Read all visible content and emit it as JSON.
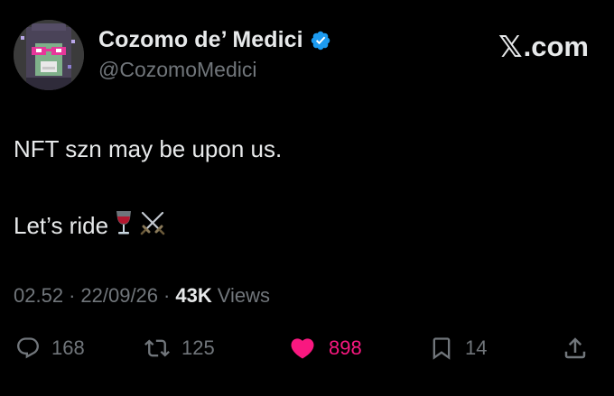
{
  "author": {
    "display_name": "Cozomo de’ Medici",
    "handle": "@CozomoMedici",
    "verified": true,
    "verified_color": "#1d9bf0"
  },
  "brand": {
    "x_glyph": "𝕏",
    "suffix": ".com"
  },
  "tweet": {
    "line1": "NFT szn may be upon us.",
    "line2_text": "Let’s ride",
    "line2_emoji": [
      "wine-glass-icon",
      "crossed-swords-icon"
    ]
  },
  "meta": {
    "time": "02.52",
    "separator": "·",
    "date": "22/09/26",
    "views_count": "43K",
    "views_label": "Views"
  },
  "actions": {
    "replies": "168",
    "reposts": "125",
    "likes": "898",
    "bookmarks": "14"
  },
  "colors": {
    "background": "#000000",
    "text": "#e7e9ea",
    "secondary": "#71767b",
    "like": "#f91880"
  }
}
